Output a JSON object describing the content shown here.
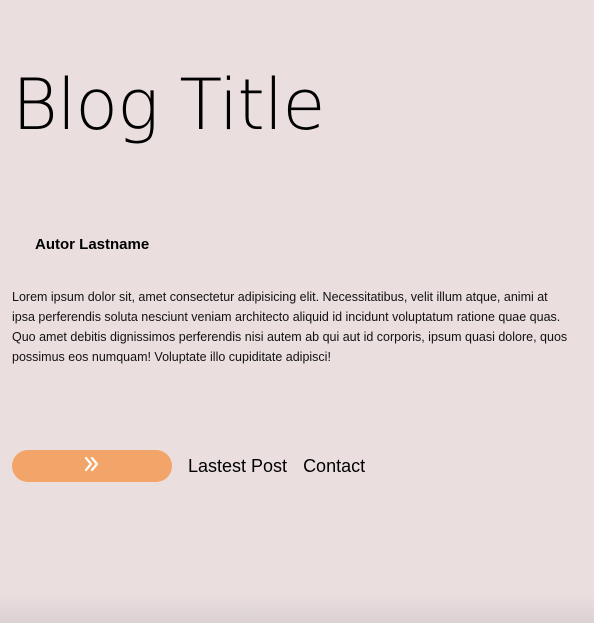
{
  "page": {
    "title": "Blog Title",
    "author": "Autor Lastname",
    "body": "Lorem ipsum dolor sit, amet consectetur adipisicing elit. Necessitatibus, velit illum atque, animi at ipsa perferendis soluta nesciunt veniam architecto aliquid id incidunt voluptatum ratione quae quas. Quo amet debitis dignissimos perferendis nisi autem ab qui aut id corporis, ipsum quasi dolore, quos possimus eos numquam! Voluptate illo cupiditate adipisci!"
  },
  "navigation": {
    "button_icon": "double-chevron-right-icon",
    "links": [
      {
        "label": "Lastest Post"
      },
      {
        "label": "Contact"
      }
    ]
  },
  "colors": {
    "background": "#eadedf",
    "accent_button": "#f3a469",
    "text": "#000000"
  }
}
